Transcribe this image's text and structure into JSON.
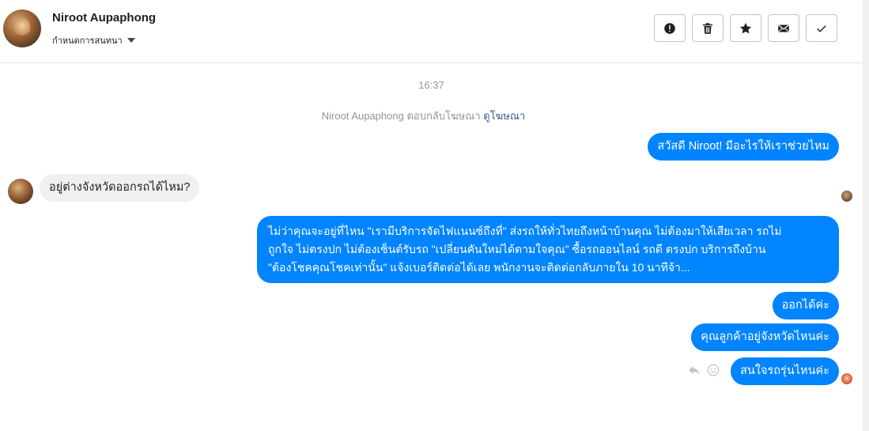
{
  "header": {
    "contact_name": "Niroot Aupaphong",
    "status_label": "กำหนดการสนทนา",
    "toolbar": [
      {
        "icon": "alert-icon",
        "name": "mark-spam-button"
      },
      {
        "icon": "trash-icon",
        "name": "delete-button"
      },
      {
        "icon": "star-icon",
        "name": "star-button"
      },
      {
        "icon": "envelope-icon",
        "name": "mark-unread-button"
      },
      {
        "icon": "check-icon",
        "name": "mark-done-button"
      }
    ]
  },
  "conversation": {
    "timestamp": "16:37",
    "notice_text": "Niroot Aupaphong ตอบกลับโฆษณา ",
    "notice_link": "ดูโฆษณา",
    "messages": [
      {
        "from": "page",
        "text": "สวัสดี Niroot! มีอะไรให้เราช่วยไหม"
      },
      {
        "from": "customer",
        "text": "อยู่ต่างจังหวัดออกรถได้ไหม?"
      },
      {
        "from": "page",
        "lines": [
          "ไม่ว่าคุณจะอยู่ที่ไหน \"เรามีบริการจัดไฟแนนซ์ถึงที่\"  ส่งรถให้ทั่วไทยถึงหน้าบ้านคุณ ไม่ต้องมาให้เสียเวลา รถไม่",
          "ถูกใจ ไม่ตรงปก ไม่ต้องเซ็นต์รับรถ \"เปลี่ยนคันใหม่ได้ตามใจคุณ\" ซื้อรถออนไลน์ รถดี ตรงปก บริการถึงบ้าน",
          "\"ต้องโชคคุณโชคเท่านั้น\" แจ้งเบอร์ติดต่อได้เลย พนักงานจะติดต่อกลับภายใน 10 นาทีจ้า..."
        ]
      },
      {
        "from": "page",
        "text": "ออกได้ค่ะ"
      },
      {
        "from": "page",
        "text": "คุณลูกค้าอยู่จังหวัดไหนค่ะ"
      },
      {
        "from": "page",
        "text": "สนใจรถรุ่นไหนค่ะ"
      }
    ]
  },
  "colors": {
    "outgoing_bubble": "#0084ff",
    "incoming_bubble": "#f1f0f0",
    "link": "#385898",
    "meta_text": "#90949c"
  }
}
